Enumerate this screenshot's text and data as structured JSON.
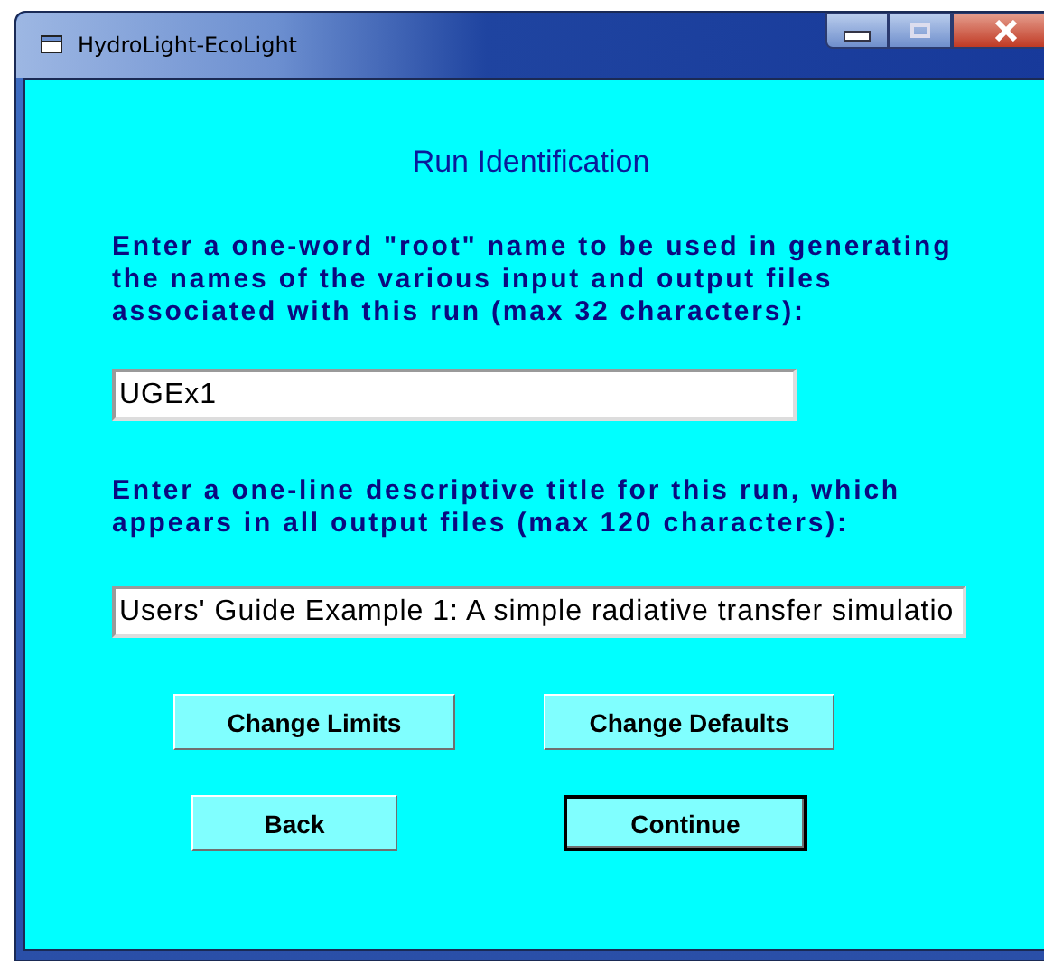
{
  "window": {
    "title": "HydroLight-EcoLight"
  },
  "heading": "Run Identification",
  "root_prompt": "Enter a one-word \"root\" name to be used in generating\nthe names of the various input and output files\nassociated with this run (max 32 characters):",
  "root_field": {
    "value": "UGEx1"
  },
  "title_prompt": "Enter a one-line descriptive title for this run, which\nappears in all output files (max 120 characters):",
  "title_field": {
    "value": "Users' Guide Example 1: A simple radiative transfer simulatio"
  },
  "buttons": [
    {
      "label": "Change Limits",
      "default": false
    },
    {
      "label": "Change Defaults",
      "default": false
    },
    {
      "label": "Back",
      "default": false
    },
    {
      "label": "Continue",
      "default": true
    }
  ]
}
